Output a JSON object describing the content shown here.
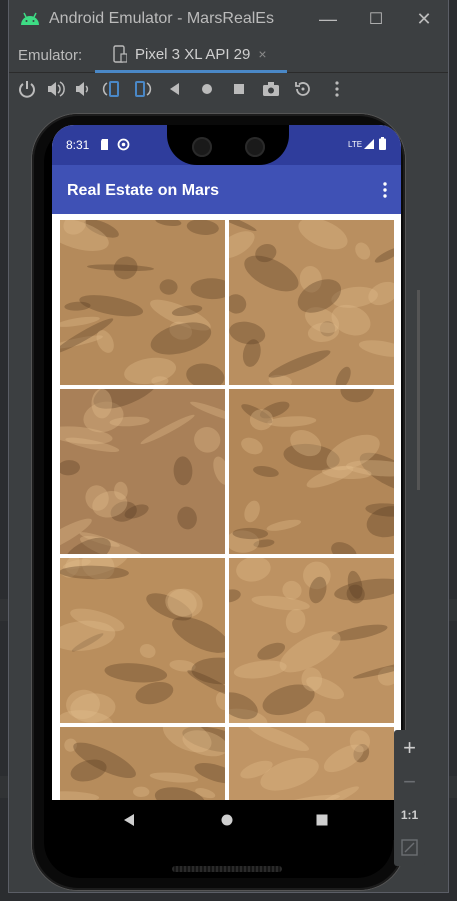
{
  "window": {
    "title": "Android Emulator - MarsRealEs",
    "controls": {
      "minimize": "—",
      "maximize": "☐",
      "close": "✕"
    }
  },
  "tabs": {
    "label": "Emulator:",
    "active": {
      "name": "Pixel 3 XL API 29",
      "close": "×"
    }
  },
  "toolbar": {
    "icons": [
      "power-icon",
      "volume-up-icon",
      "volume-down-icon",
      "rotate-left-icon",
      "rotate-right-icon",
      "back-icon",
      "home-icon",
      "overview-icon",
      "camera-icon",
      "replay-icon",
      "more-icon"
    ]
  },
  "device": {
    "status": {
      "time": "8:31",
      "network": "LTE"
    },
    "app": {
      "title": "Real Estate on Mars"
    },
    "grid": {
      "columns": 2,
      "tiles": [
        {
          "name": "mars-photo-1",
          "tone": "#b48a5b"
        },
        {
          "name": "mars-photo-2",
          "tone": "#b98f60"
        },
        {
          "name": "mars-photo-3",
          "tone": "#a98058"
        },
        {
          "name": "mars-photo-4",
          "tone": "#b28758"
        },
        {
          "name": "mars-photo-5",
          "tone": "#b98e5d"
        },
        {
          "name": "mars-photo-6",
          "tone": "#bd9262"
        },
        {
          "name": "mars-photo-7",
          "tone": "#b68c5c"
        },
        {
          "name": "mars-photo-8",
          "tone": "#c09565"
        }
      ]
    }
  },
  "side_panel": {
    "zoom_in": "+",
    "zoom_out": "−",
    "actual_size": "1:1"
  },
  "colors": {
    "primary": "#3f51b5",
    "primary_dark": "#2f3d9c",
    "accent_tab": "#4a88c7"
  }
}
